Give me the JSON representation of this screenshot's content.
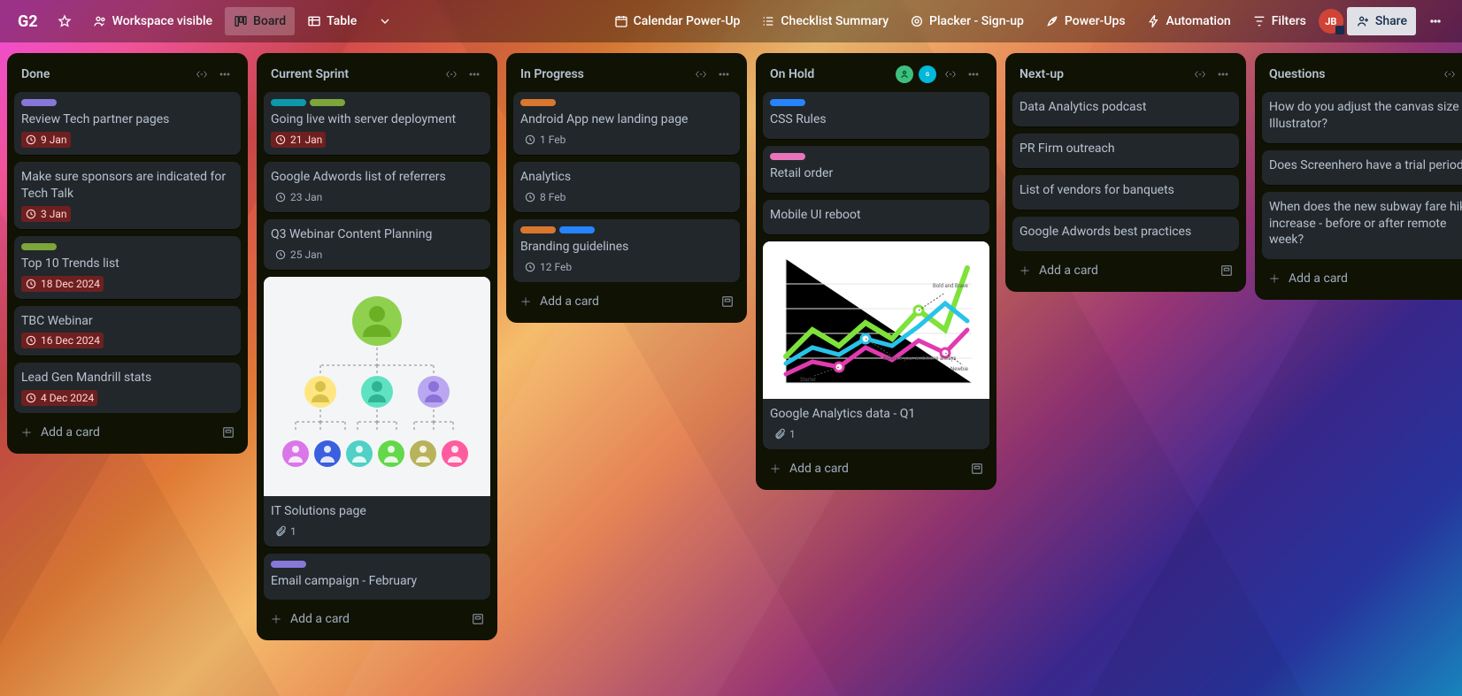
{
  "header": {
    "board_title": "G2",
    "workspace_visible": "Workspace visible",
    "views": {
      "board": "Board",
      "table": "Table"
    },
    "powerups": {
      "calendar": "Calendar Power-Up",
      "checklist": "Checklist Summary",
      "placker": "Placker - Sign-up",
      "powerups": "Power-Ups",
      "automation": "Automation",
      "filters": "Filters",
      "share": "Share"
    },
    "avatar_initials": "JB",
    "add_card_label": "Add a card"
  },
  "lists": [
    {
      "title": "Done",
      "cards": [
        {
          "labels": [
            "#8777d9"
          ],
          "title": "Review Tech partner pages",
          "due": "9 Jan",
          "overdue": true
        },
        {
          "title": "Make sure sponsors are indicated for Tech Talk",
          "due": "3 Jan",
          "overdue": true
        },
        {
          "labels": [
            "#7da53b"
          ],
          "title": "Top 10 Trends list",
          "due": "18 Dec 2024",
          "overdue": true
        },
        {
          "title": "TBC Webinar",
          "due": "16 Dec 2024",
          "overdue": true
        },
        {
          "title": "Lead Gen Mandrill stats",
          "due": "4 Dec 2024",
          "overdue": true
        }
      ]
    },
    {
      "title": "Current Sprint",
      "cards": [
        {
          "labels": [
            "#0c9aab",
            "#7da53b"
          ],
          "title": "Going live with server deployment",
          "due": "21 Jan",
          "overdue": true
        },
        {
          "title": "Google Adwords list of referrers",
          "due": "23 Jan"
        },
        {
          "title": "Q3 Webinar Content Planning",
          "due": "25 Jan"
        },
        {
          "cover": "org",
          "title": "IT Solutions page",
          "attachments": 1
        },
        {
          "labels": [
            "#8777d9"
          ],
          "title": "Email campaign - February"
        }
      ]
    },
    {
      "title": "In Progress",
      "cards": [
        {
          "labels": [
            "#d9772f"
          ],
          "title": "Android App new landing page",
          "due": "1 Feb"
        },
        {
          "title": "Analytics",
          "due": "8 Feb"
        },
        {
          "labels": [
            "#d9772f",
            "#2684ff"
          ],
          "title": "Branding guidelines",
          "due": "12 Feb"
        }
      ]
    },
    {
      "title": "On Hold",
      "chips": true,
      "cards": [
        {
          "labels": [
            "#2684ff"
          ],
          "title": "CSS Rules"
        },
        {
          "labels": [
            "#e774bb"
          ],
          "title": "Retail order"
        },
        {
          "title": "Mobile UI reboot"
        },
        {
          "cover": "chart",
          "title": "Google Analytics data - Q1",
          "attachments": 1
        }
      ]
    },
    {
      "title": "Next-up",
      "cards": [
        {
          "title": "Data Analytics podcast"
        },
        {
          "title": "PR Firm outreach"
        },
        {
          "title": "List of vendors for banquets"
        },
        {
          "title": "Google Adwords best practices"
        }
      ]
    },
    {
      "title": "Questions",
      "cards": [
        {
          "title": "How do you adjust the canvas size in Illustrator?"
        },
        {
          "title": "Does Screenhero have a trial period?"
        },
        {
          "title": "When does the new subway fare hike increase - before or after remote week?"
        }
      ]
    }
  ]
}
